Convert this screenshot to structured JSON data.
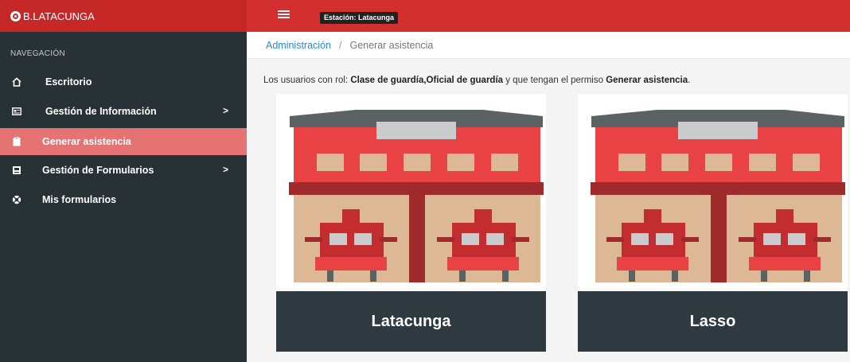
{
  "header": {
    "brand": "B.LATACUNGA",
    "station_badge": "Estación: Latacunga"
  },
  "sidebar": {
    "section_title": "NAVEGACIÓN",
    "items": [
      {
        "label": "Escritorio",
        "icon": "home-icon",
        "has_submenu": false,
        "active": false
      },
      {
        "label": "Gestión de Información",
        "icon": "id-card-icon",
        "has_submenu": true,
        "submenu_indicator": ">",
        "active": false
      },
      {
        "label": "Generar asistencia",
        "icon": "clipboard-icon",
        "has_submenu": false,
        "active": true
      },
      {
        "label": "Gestión de Formularios",
        "icon": "form-icon",
        "has_submenu": true,
        "submenu_indicator": ">",
        "active": false
      },
      {
        "label": "Mis formularios",
        "icon": "lifebuoy-icon",
        "has_submenu": false,
        "active": false
      }
    ]
  },
  "breadcrumb": {
    "parent": "Administración",
    "separator": "/",
    "current": "Generar asistencia"
  },
  "notice": {
    "prefix": "Los usuarios con rol: ",
    "roles": "Clase de guardía,Oficial de guardía",
    "middle": " y que tengan el permiso ",
    "permission": "Generar asistencia",
    "suffix": "."
  },
  "stations": [
    {
      "name": "Latacunga",
      "image": "fire-station-illustration"
    },
    {
      "name": "Lasso",
      "image": "fire-station-illustration"
    }
  ],
  "colors": {
    "topbar": "#d32f2f",
    "sidebar": "#283236",
    "active_item": "#e57373",
    "link": "#2a8bd8",
    "card_label": "#2f3a40"
  }
}
